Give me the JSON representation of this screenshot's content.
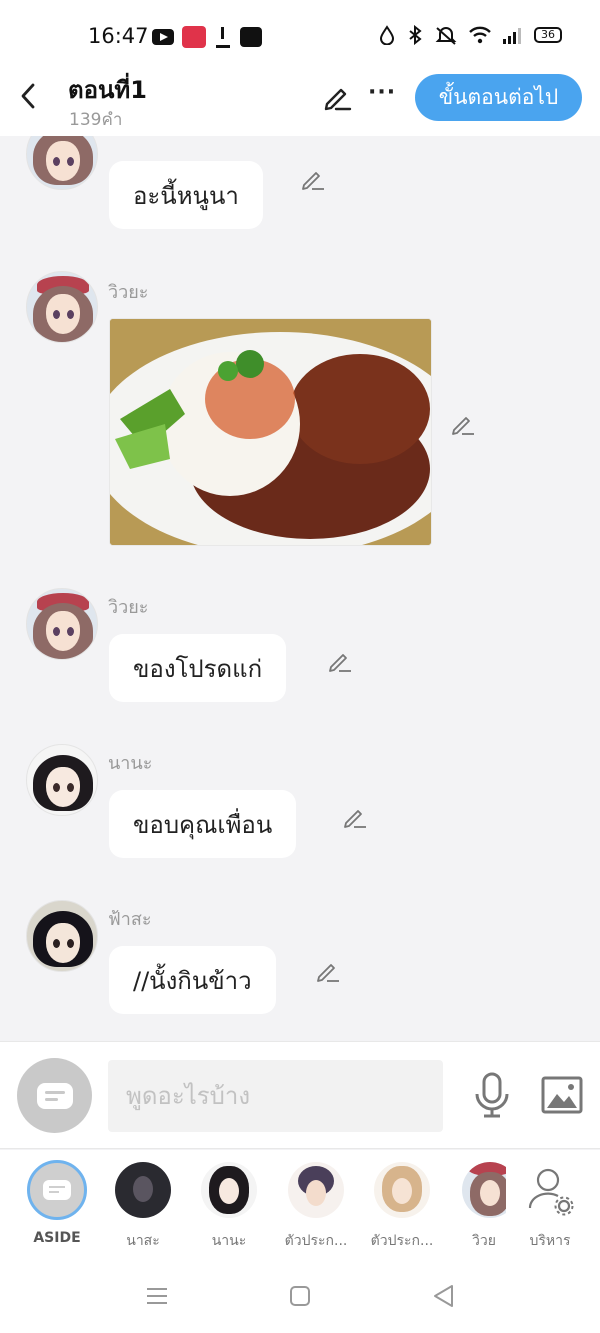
{
  "status_bar": {
    "time": "16:47",
    "battery": "36",
    "left_icons": [
      "youtube-icon",
      "manga-toon-icon",
      "download-icon",
      "webtoon-icon"
    ],
    "right_icons": [
      "data-saver-icon",
      "bluetooth-icon",
      "mute-icon",
      "wifi-icon",
      "signal-icon",
      "battery-icon"
    ]
  },
  "header": {
    "title": "ตอนที่1",
    "word_count": "139คำ",
    "next_button": "ขั้นตอนต่อไป",
    "more": "···"
  },
  "messages": [
    {
      "sender": "",
      "text": "อะนี้หนูนา",
      "type": "text",
      "avatar": "wiya"
    },
    {
      "sender": "วิวยะ",
      "text": "",
      "type": "image",
      "avatar": "wiya"
    },
    {
      "sender": "วิวยะ",
      "text": "ของโปรดแก่",
      "type": "text",
      "avatar": "wiya"
    },
    {
      "sender": "นานะ",
      "text": "ขอบคุณเพื่อน",
      "type": "text",
      "avatar": "nana"
    },
    {
      "sender": "ฟ้าสะ",
      "text": "//นั้งกินข้าว",
      "type": "text",
      "avatar": "fasa"
    }
  ],
  "input": {
    "placeholder": "พูดอะไรบ้าง"
  },
  "characters": [
    {
      "label": "ASIDE"
    },
    {
      "label": "นาสะ"
    },
    {
      "label": "นานะ"
    },
    {
      "label": "ตัวประก..."
    },
    {
      "label": "ตัวประก..."
    },
    {
      "label": "วิวย"
    },
    {
      "label": "บริหาร"
    }
  ],
  "colors": {
    "accent": "#4aa4ef",
    "background": "#f3f3f5",
    "bubble": "#ffffff"
  }
}
